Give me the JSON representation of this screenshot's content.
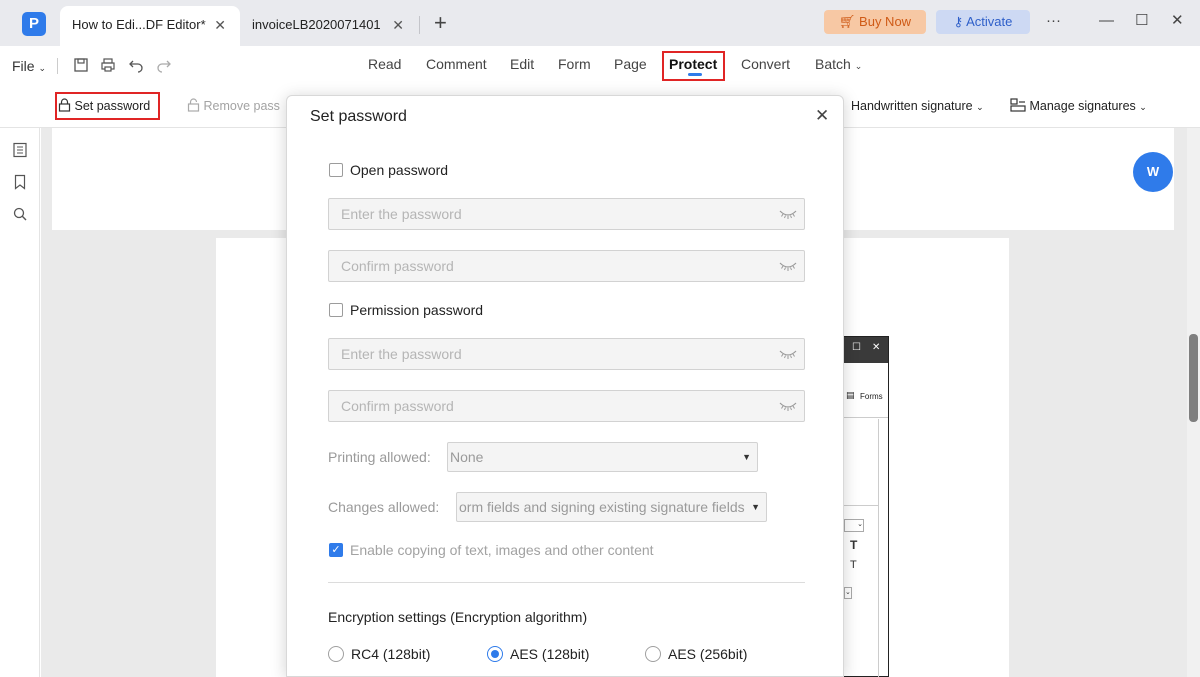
{
  "window": {
    "tabs": [
      {
        "label": "How to Edi...DF Editor*",
        "active": true
      },
      {
        "label": "invoiceLB2020071401",
        "active": false
      }
    ],
    "buy_now": "Buy Now",
    "activate": "Activate",
    "controls": {
      "more": "···",
      "minimize": "—",
      "maximize": "☐",
      "close": "✕"
    }
  },
  "menubar": {
    "file": "File",
    "items": [
      "Read",
      "Comment",
      "Edit",
      "Form",
      "Page",
      "Protect",
      "Convert",
      "Batch"
    ],
    "active": "Protect"
  },
  "toolbar": {
    "set_password": "Set password",
    "remove_password": "Remove pass",
    "handwritten_signature": "Handwritten signature",
    "manage_signatures": "Manage signatures"
  },
  "embedded": {
    "forms_label": "Forms"
  },
  "dialog": {
    "title": "Set password",
    "open_password": {
      "label": "Open password",
      "checked": false,
      "enter_placeholder": "Enter the password",
      "confirm_placeholder": "Confirm password"
    },
    "permission_password": {
      "label": "Permission password",
      "checked": false,
      "enter_placeholder": "Enter the password",
      "confirm_placeholder": "Confirm password"
    },
    "printing_allowed": {
      "label": "Printing allowed:",
      "value": "None"
    },
    "changes_allowed": {
      "label": "Changes allowed:",
      "value": "orm fields and signing existing signature fields"
    },
    "enable_copying": {
      "label": "Enable copying of text, images and other content",
      "checked": true
    },
    "encryption": {
      "title": "Encryption settings (Encryption algorithm)",
      "options": [
        "RC4 (128bit)",
        "AES (128bit)",
        "AES (256bit)"
      ],
      "selected": "AES (128bit)"
    }
  },
  "colors": {
    "accent": "#2f7bea",
    "highlight_border": "#e02525",
    "buy": "#cf5a16"
  }
}
